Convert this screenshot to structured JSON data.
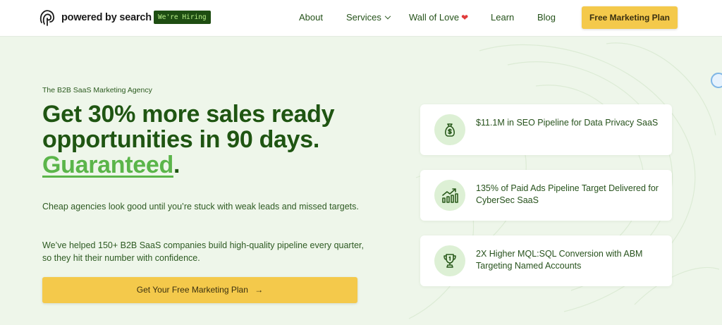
{
  "header": {
    "logo_text": "powered by search",
    "hiring_badge": "We're Hiring",
    "nav": [
      {
        "label": "About"
      },
      {
        "label": "Services"
      },
      {
        "label": "Wall of Love"
      },
      {
        "label": "Learn"
      },
      {
        "label": "Blog"
      }
    ],
    "cta": "Free Marketing Plan"
  },
  "hero": {
    "eyebrow": "The B2B SaaS Marketing Agency",
    "headline_line1": "Get 30% more sales ready",
    "headline_line2": "opportunities in 90 days.",
    "headline_accent": "Guaranteed",
    "headline_period": ".",
    "paragraph1": "Cheap agencies look good until you’re stuck with weak leads and missed targets.",
    "paragraph2": "We’ve helped 150+ B2B SaaS companies build high-quality pipeline every quarter, so they hit their number with confidence.",
    "cta": "Get Your Free Marketing Plan",
    "cta_arrow": "→"
  },
  "cards": [
    {
      "text": "$11.1M in SEO Pipeline for Data Privacy SaaS",
      "icon": "money-bag-icon"
    },
    {
      "text": "135% of Paid Ads Pipeline Target Delivered for CyberSec SaaS",
      "icon": "growth-chart-icon"
    },
    {
      "text": "2X Higher MQL:SQL Conversion with ABM Targeting Named Accounts",
      "icon": "trophy-icon"
    }
  ],
  "colors": {
    "accent_green": "#5bb54a",
    "dark_green": "#1f5512",
    "cta_yellow": "#f4c94b",
    "background": "#eef6ea"
  }
}
